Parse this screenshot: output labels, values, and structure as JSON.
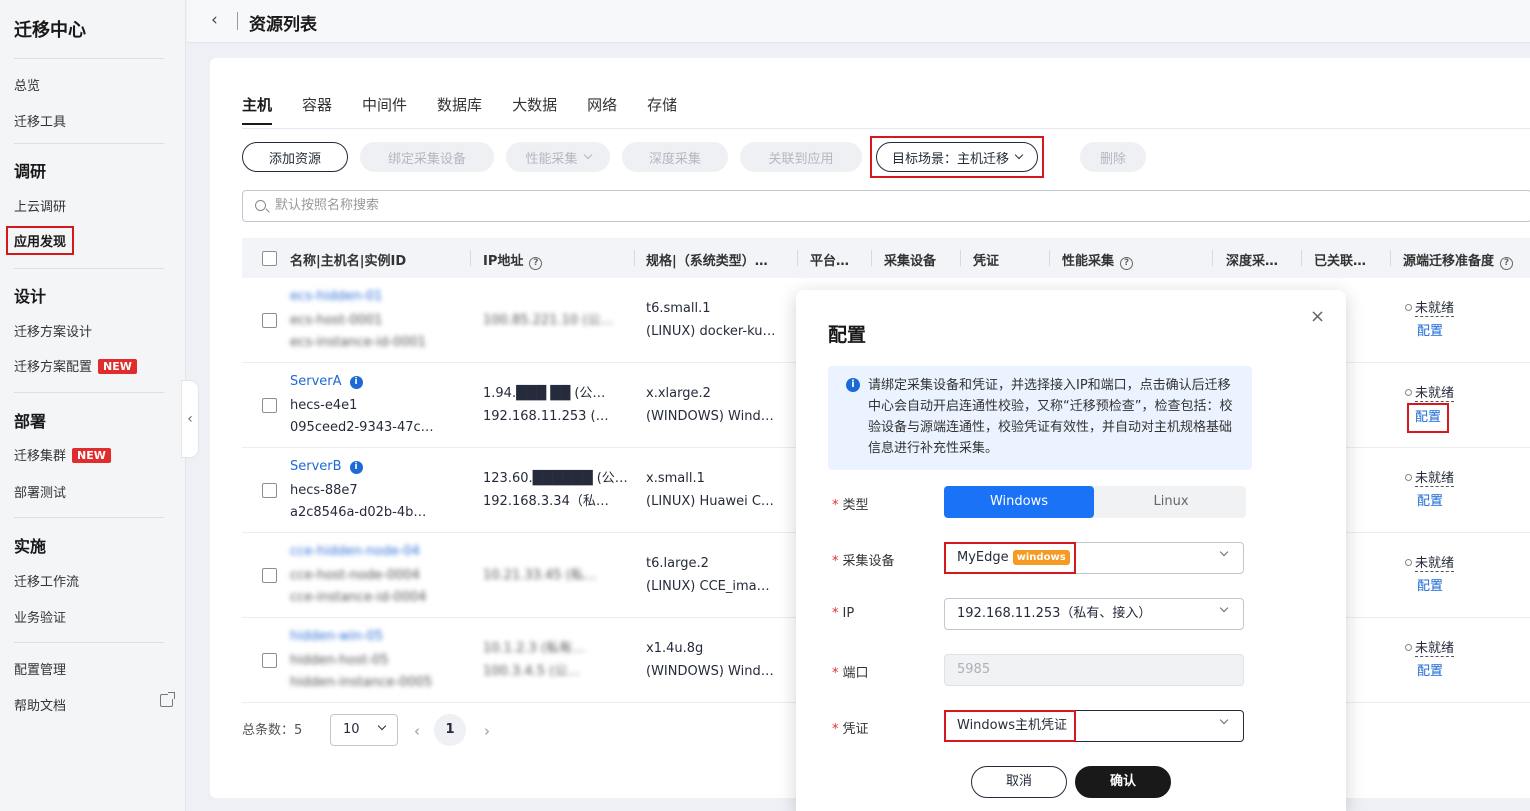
{
  "sidebar": {
    "title": "迁移中心",
    "items": {
      "overview": "总览",
      "tools": "迁移工具",
      "group_research": "调研",
      "cloud_research": "上云调研",
      "app_discovery": "应用发现",
      "group_design": "设计",
      "plan_design": "迁移方案设计",
      "plan_config": "迁移方案配置",
      "group_deploy": "部署",
      "cluster": "迁移集群",
      "deploy_test": "部署测试",
      "group_impl": "实施",
      "workflow": "迁移工作流",
      "biz_verify": "业务验证",
      "config_mgmt": "配置管理",
      "help_doc": "帮助文档"
    },
    "new_badge": "NEW"
  },
  "header": {
    "back": "<",
    "title": "资源列表"
  },
  "tabs": [
    "主机",
    "容器",
    "中间件",
    "数据库",
    "大数据",
    "网络",
    "存储"
  ],
  "toolbar": {
    "add": "添加资源",
    "bind": "绑定采集设备",
    "perf": "性能采集",
    "deep": "深度采集",
    "link_app": "关联到应用",
    "scene": "目标场景：主机迁移",
    "delete": "删除"
  },
  "search": {
    "placeholder": "默认按照名称搜索"
  },
  "table": {
    "headers": {
      "name": "名称|主机名|实例ID",
      "ip": "IP地址",
      "spec": "规格|（系统类型）…",
      "platform": "平台…",
      "device": "采集设备",
      "cred": "凭证",
      "perf": "性能采集",
      "deep": "深度采…",
      "linked": "已关联…",
      "ready": "源端迁移准备度"
    },
    "rows": [
      {
        "name": "ecs-hidden-01",
        "host": "ecs-host-0001",
        "id": "ecs-instance-id-0001",
        "ip1": "100.85.221.10 (公…",
        "ip2": "",
        "spec1": "t6.small.1",
        "spec2": "(LINUX) docker-ku…",
        "status": "未就绪",
        "action": "配置",
        "blur": true
      },
      {
        "name": "ServerA",
        "host": "hecs-e4e1",
        "id": "095ceed2-9343-47c…",
        "ip1": "1.94.███ ██ (公…",
        "ip2": "192.168.11.253 (…",
        "spec1": "x.xlarge.2",
        "spec2": "(WINDOWS) Wind…",
        "status": "未就绪",
        "action": "配置",
        "blur": false
      },
      {
        "name": "ServerB",
        "host": "hecs-88e7",
        "id": "a2c8546a-d02b-4b…",
        "ip1": "123.60.██████ (公…",
        "ip2": "192.168.3.34（私…",
        "spec1": "x.small.1",
        "spec2": "(LINUX) Huawei C…",
        "status": "未就绪",
        "action": "配置",
        "blur": false
      },
      {
        "name": "cce-hidden-node-04",
        "host": "cce-host-node-0004",
        "id": "cce-instance-id-0004",
        "ip1": "10.21.33.45 (私…",
        "ip2": "",
        "spec1": "t6.large.2",
        "spec2": "(LINUX) CCE_ima…",
        "status": "未就绪",
        "action": "配置",
        "blur": true
      },
      {
        "name": "hidden-win-05",
        "host": "hidden-host-05",
        "id": "hidden-instance-0005",
        "ip1": "10.1.2.3 (私有…",
        "ip2": "100.3.4.5 (公…",
        "spec1": "x1.4u.8g",
        "spec2": "(WINDOWS) Wind…",
        "status": "未就绪",
        "action": "配置",
        "blur": true
      }
    ]
  },
  "pager": {
    "total": "总条数：5",
    "size": "10",
    "current": "1"
  },
  "modal": {
    "title": "配置",
    "close": "×",
    "alert": "请绑定采集设备和凭证，并选择接入IP和端口，点击确认后迁移中心会自动开启连通性校验，又称“迁移预检查”，检查包括：校验设备与源端连通性，校验凭证有效性，并自动对主机规格基础信息进行补充性采集。",
    "labels": {
      "type": "类型",
      "device": "采集设备",
      "ip": "IP",
      "port": "端口",
      "cred": "凭证"
    },
    "type_options": [
      "Windows",
      "Linux"
    ],
    "device_value": "MyEdge",
    "device_tag": "windows",
    "ip_value": "192.168.11.253（私有、接入）",
    "port_placeholder": "5985",
    "cred_value": "Windows主机凭证",
    "cancel": "取消",
    "confirm": "确认"
  }
}
